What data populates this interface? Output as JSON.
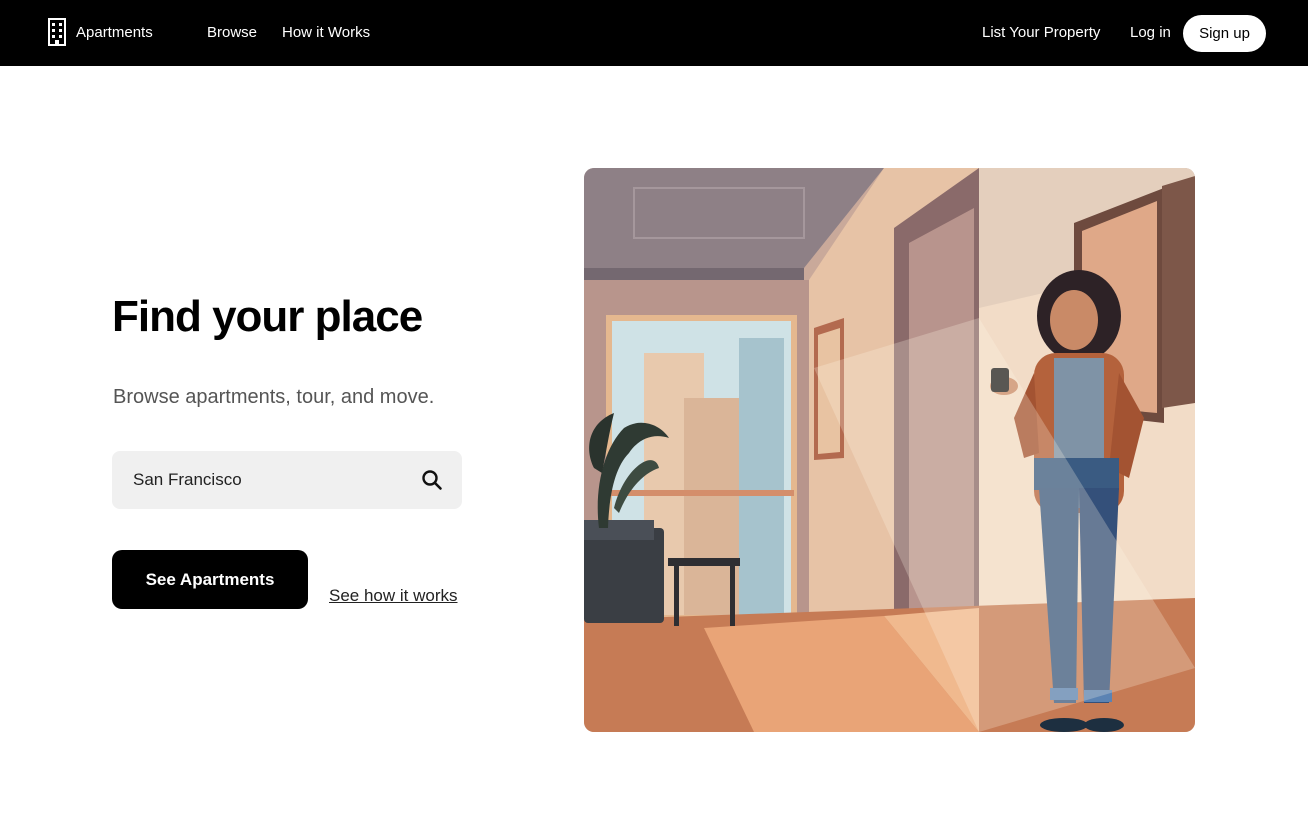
{
  "nav": {
    "brand": "Apartments",
    "links": [
      "Browse",
      "How it Works"
    ],
    "list_property": "List Your Property",
    "login": "Log in",
    "signup": "Sign up"
  },
  "hero": {
    "title": "Find your place",
    "subtitle": "Browse apartments, tour, and move.",
    "search": {
      "value": "San Francisco",
      "icon": "search-icon"
    },
    "cta": "See Apartments",
    "secondary_link": "See how it works"
  },
  "icons": {
    "brand": "building-icon"
  },
  "colors": {
    "nav_bg": "#000000",
    "cta_bg": "#000000",
    "search_bg": "#f0f0f0"
  }
}
